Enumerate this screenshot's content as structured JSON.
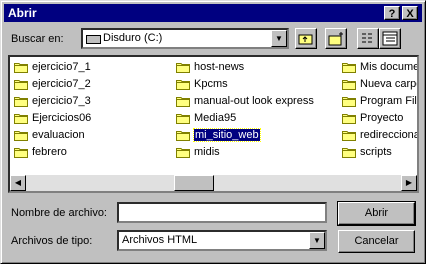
{
  "window": {
    "title": "Abrir"
  },
  "titlebar": {
    "help_label": "?",
    "close_label": "X"
  },
  "lookin": {
    "label": "Buscar en:",
    "value": "Disduro (C:)"
  },
  "files": {
    "columns": [
      [
        "ejercicio7_1",
        "ejercicio7_2",
        "ejercicio7_3",
        "Ejercicios06",
        "evaluacion",
        "febrero"
      ],
      [
        "host-news",
        "Kpcms",
        "manual-out look express",
        "Media95",
        "mi_sitio_web",
        "midis"
      ],
      [
        "Mis documentos",
        "Nueva carpeta",
        "Program Files",
        "Proyecto",
        "redireccionar",
        "scripts"
      ]
    ],
    "selected": "mi_sitio_web"
  },
  "filename": {
    "label": "Nombre de archivo:",
    "value": ""
  },
  "filetype": {
    "label": "Archivos de tipo:",
    "value": "Archivos HTML"
  },
  "buttons": {
    "open": "Abrir",
    "cancel": "Cancelar"
  }
}
